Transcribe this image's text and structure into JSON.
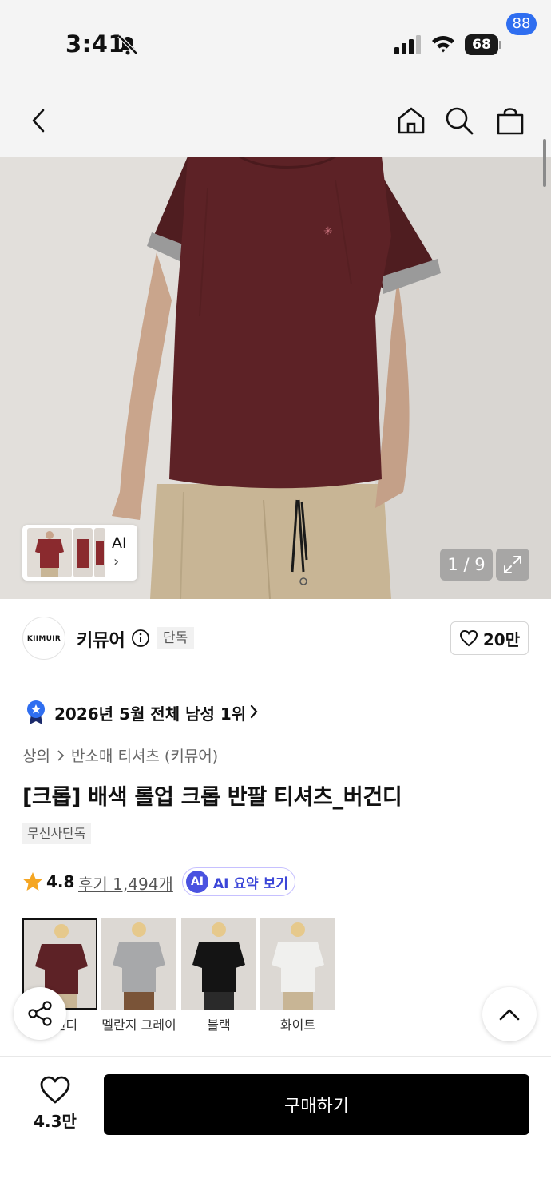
{
  "status_bar": {
    "time": "3:41",
    "battery": "68"
  },
  "nav": {
    "cart_count": "88"
  },
  "gallery": {
    "ai_label": "AI",
    "page_indicator": "1 / 9"
  },
  "brand": {
    "logo_text": "KIIMUIR",
    "name": "키뮤어",
    "tag": "단독",
    "like_count": "20만"
  },
  "ranking": {
    "text": "2026년 5월 전체 남성 1위"
  },
  "breadcrumb": {
    "level1": "상의",
    "level2": "반소매 티셔츠 (키뮤어)"
  },
  "product": {
    "title": "[크롭] 배색 롤업 크롭 반팔 티셔츠_버건디",
    "exclusive_tag": "무신사단독"
  },
  "rating": {
    "score": "4.8",
    "reviews": "후기 1,494개",
    "ai_chip": "AI",
    "ai_summary": "AI 요약 보기"
  },
  "colors": [
    {
      "label": "버건디",
      "shirt": "#5d2226",
      "selected": true
    },
    {
      "label": "멜란지 그레이",
      "shirt": "#a7a8aa",
      "selected": false
    },
    {
      "label": "블랙",
      "shirt": "#141414",
      "selected": false
    },
    {
      "label": "화이트",
      "shirt": "#f0f0ee",
      "selected": false
    }
  ],
  "bottom_bar": {
    "wish_count": "4.3만",
    "buy_label": "구매하기"
  },
  "theme": {
    "accent_blue": "#2f6ef0",
    "ai_purple": "#4a52e0",
    "star": "#f5a623",
    "shirt_burgundy": "#5d2226",
    "pants_khaki": "#c8b595"
  },
  "icons": [
    "bell-off-icon",
    "signal-icon",
    "wifi-icon",
    "battery-icon",
    "back-icon",
    "home-icon",
    "search-icon",
    "cart-icon",
    "expand-icon",
    "info-icon",
    "heart-icon",
    "ranking-badge-icon",
    "chevron-right-icon",
    "star-icon",
    "share-icon",
    "chevron-up-icon"
  ]
}
